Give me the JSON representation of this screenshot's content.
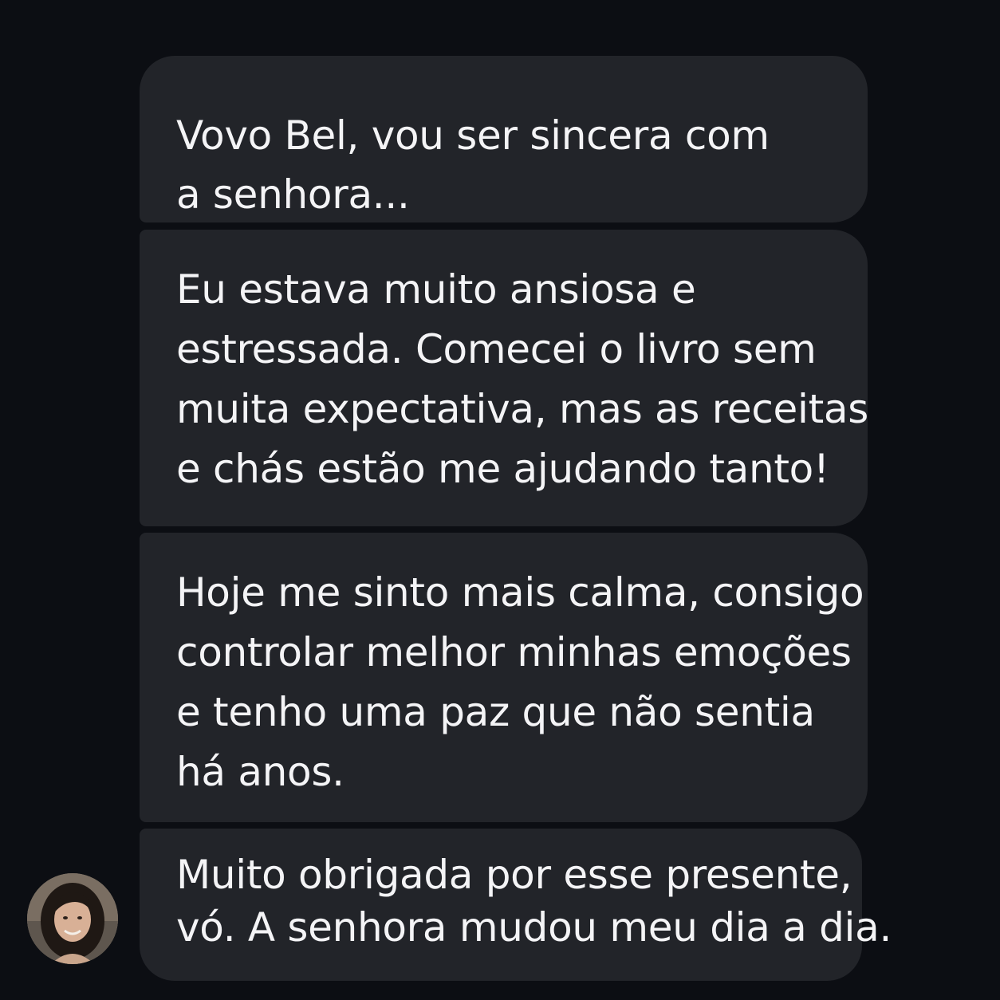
{
  "messages": [
    {
      "text": "Vovo Bel, vou ser sincera com\na senhora..."
    },
    {
      "text": "Eu estava muito ansiosa e\nestressada. Comecei o livro sem\nmuita expectativa, mas as receitas\ne chás estão me ajudando tanto!"
    },
    {
      "text": "Hoje me sinto mais calma, consigo\ncontrolar melhor minhas emoções\ne tenho uma paz que não sentia\nhá anos."
    },
    {
      "text": "Muito obrigada por esse presente,\nvó. A senhora mudou meu dia a dia."
    }
  ],
  "colors": {
    "background": "#0c0e13",
    "bubble": "#222429",
    "text": "#f4f4f6"
  }
}
